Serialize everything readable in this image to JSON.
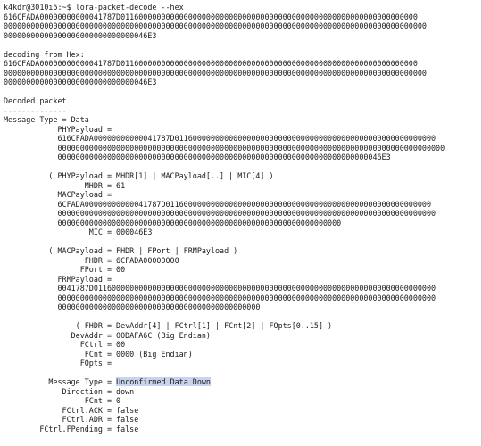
{
  "terminal": {
    "lines": [
      {
        "text": "k4kdr@3010i5:~$ lora-packet-decode --hex"
      },
      {
        "text": "616CFADA00000000000041787D011600000000000000000000000000000000000000000000000000000000000000"
      },
      {
        "text": "0000000000000000000000000000000000000000000000000000000000000000000000000000000000000000000000"
      },
      {
        "text": "00000000000000000000000000000046E3"
      },
      {
        "text": ""
      },
      {
        "text": "decoding from Hex:"
      },
      {
        "text": "616CFADA00000000000041787D011600000000000000000000000000000000000000000000000000000000000000"
      },
      {
        "text": "0000000000000000000000000000000000000000000000000000000000000000000000000000000000000000000000"
      },
      {
        "text": "00000000000000000000000000000046E3"
      },
      {
        "text": ""
      },
      {
        "text": "Decoded packet"
      },
      {
        "text": "--------------"
      },
      {
        "text": "Message Type = Data"
      },
      {
        "text": "            PHYPayload ="
      },
      {
        "text": "            616CFADA00000000000041787D0116000000000000000000000000000000000000000000000000000000"
      },
      {
        "text": "            00000000000000000000000000000000000000000000000000000000000000000000000000000000000000"
      },
      {
        "text": "            000000000000000000000000000000000000000000000000000000000000000000000046E3"
      },
      {
        "text": ""
      },
      {
        "text": "          ( PHYPayload = MHDR[1] | MACPayload[..] | MIC[4] )"
      },
      {
        "text": "                  MHDR = 61"
      },
      {
        "text": "            MACPayload ="
      },
      {
        "text": "            6CFADA00000000000041787D01160000000000000000000000000000000000000000000000000000000"
      },
      {
        "text": "            000000000000000000000000000000000000000000000000000000000000000000000000000000000000"
      },
      {
        "text": "            000000000000000000000000000000000000000000000000000000000000000"
      },
      {
        "text": "                   MIC = 000046E3"
      },
      {
        "text": ""
      },
      {
        "text": "          ( MACPayload = FHDR | FPort | FRMPayload )"
      },
      {
        "text": "                  FHDR = 6CFADA00000000"
      },
      {
        "text": "                 FPort = 00"
      },
      {
        "text": "            FRMPayload ="
      },
      {
        "text": "            0041787D0116000000000000000000000000000000000000000000000000000000000000000000000000"
      },
      {
        "text": "            000000000000000000000000000000000000000000000000000000000000000000000000000000000000"
      },
      {
        "text": "            000000000000000000000000000000000000000000000"
      },
      {
        "text": ""
      },
      {
        "text": "                ( FHDR = DevAddr[4] | FCtrl[1] | FCnt[2] | FOpts[0..15] )"
      },
      {
        "text": "               DevAddr = 00DAFA6C (Big Endian)"
      },
      {
        "text": "                 FCtrl = 00"
      },
      {
        "text": "                  FCnt = 0000 (Big Endian)"
      },
      {
        "text": "                 FOpts ="
      },
      {
        "text": ""
      },
      {
        "text": "          Message Type = ",
        "highlight": "Unconfirmed Data Down"
      },
      {
        "text": "             Direction = down"
      },
      {
        "text": "                  FCnt = 0"
      },
      {
        "text": "             FCtrl.ACK = false"
      },
      {
        "text": "             FCtrl.ADR = false"
      },
      {
        "text": "        FCtrl.FPending = false"
      }
    ]
  }
}
